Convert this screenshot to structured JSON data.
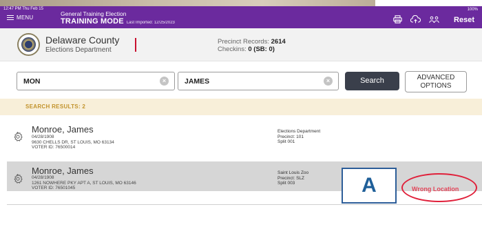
{
  "status": {
    "time": "12:47 PM  Thu Feb 15",
    "battery": "100%"
  },
  "header": {
    "menu_label": "MENU",
    "election_name": "General Training Election",
    "mode": "TRAINING MODE",
    "last_imported": "Last Imported: 12/25/2023",
    "reset_label": "Reset",
    "icons": [
      "printer-icon",
      "cloud-upload-icon",
      "users-icon"
    ]
  },
  "county": {
    "name": "Delaware County",
    "department": "Elections Department",
    "precinct_records_label": "Precinct Records:",
    "precinct_records": "2614",
    "checkins_label": "Checkins:",
    "checkins": "0 (SB: 0)"
  },
  "search": {
    "last_name": "MON",
    "first_name": "JAMES",
    "search_label": "Search",
    "advanced_line1": "ADVANCED",
    "advanced_line2": "OPTIONS"
  },
  "results": {
    "label": "SEARCH RESULTS: 2",
    "rows": [
      {
        "name": "Monroe, James",
        "dob": "04/28/1908",
        "address": "9630 CHELLS DR, ST LOUIS, MO 63134",
        "voter_id": "VOTER ID: 76500014",
        "location": "Elections Department",
        "precinct": "Precinct: 101",
        "split": "Split 001"
      },
      {
        "name": "Monroe, James",
        "dob": "04/28/1908",
        "address": "1261 NOWHERE PKY APT A, ST LOUIS, MO 63146",
        "voter_id": "VOTER ID: 76501045",
        "location": "Saint Louis Zoo",
        "precinct": "Precinct: SLZ",
        "split": "Split 003",
        "status": "Wrong Location"
      }
    ]
  },
  "annotation": {
    "label": "A"
  }
}
